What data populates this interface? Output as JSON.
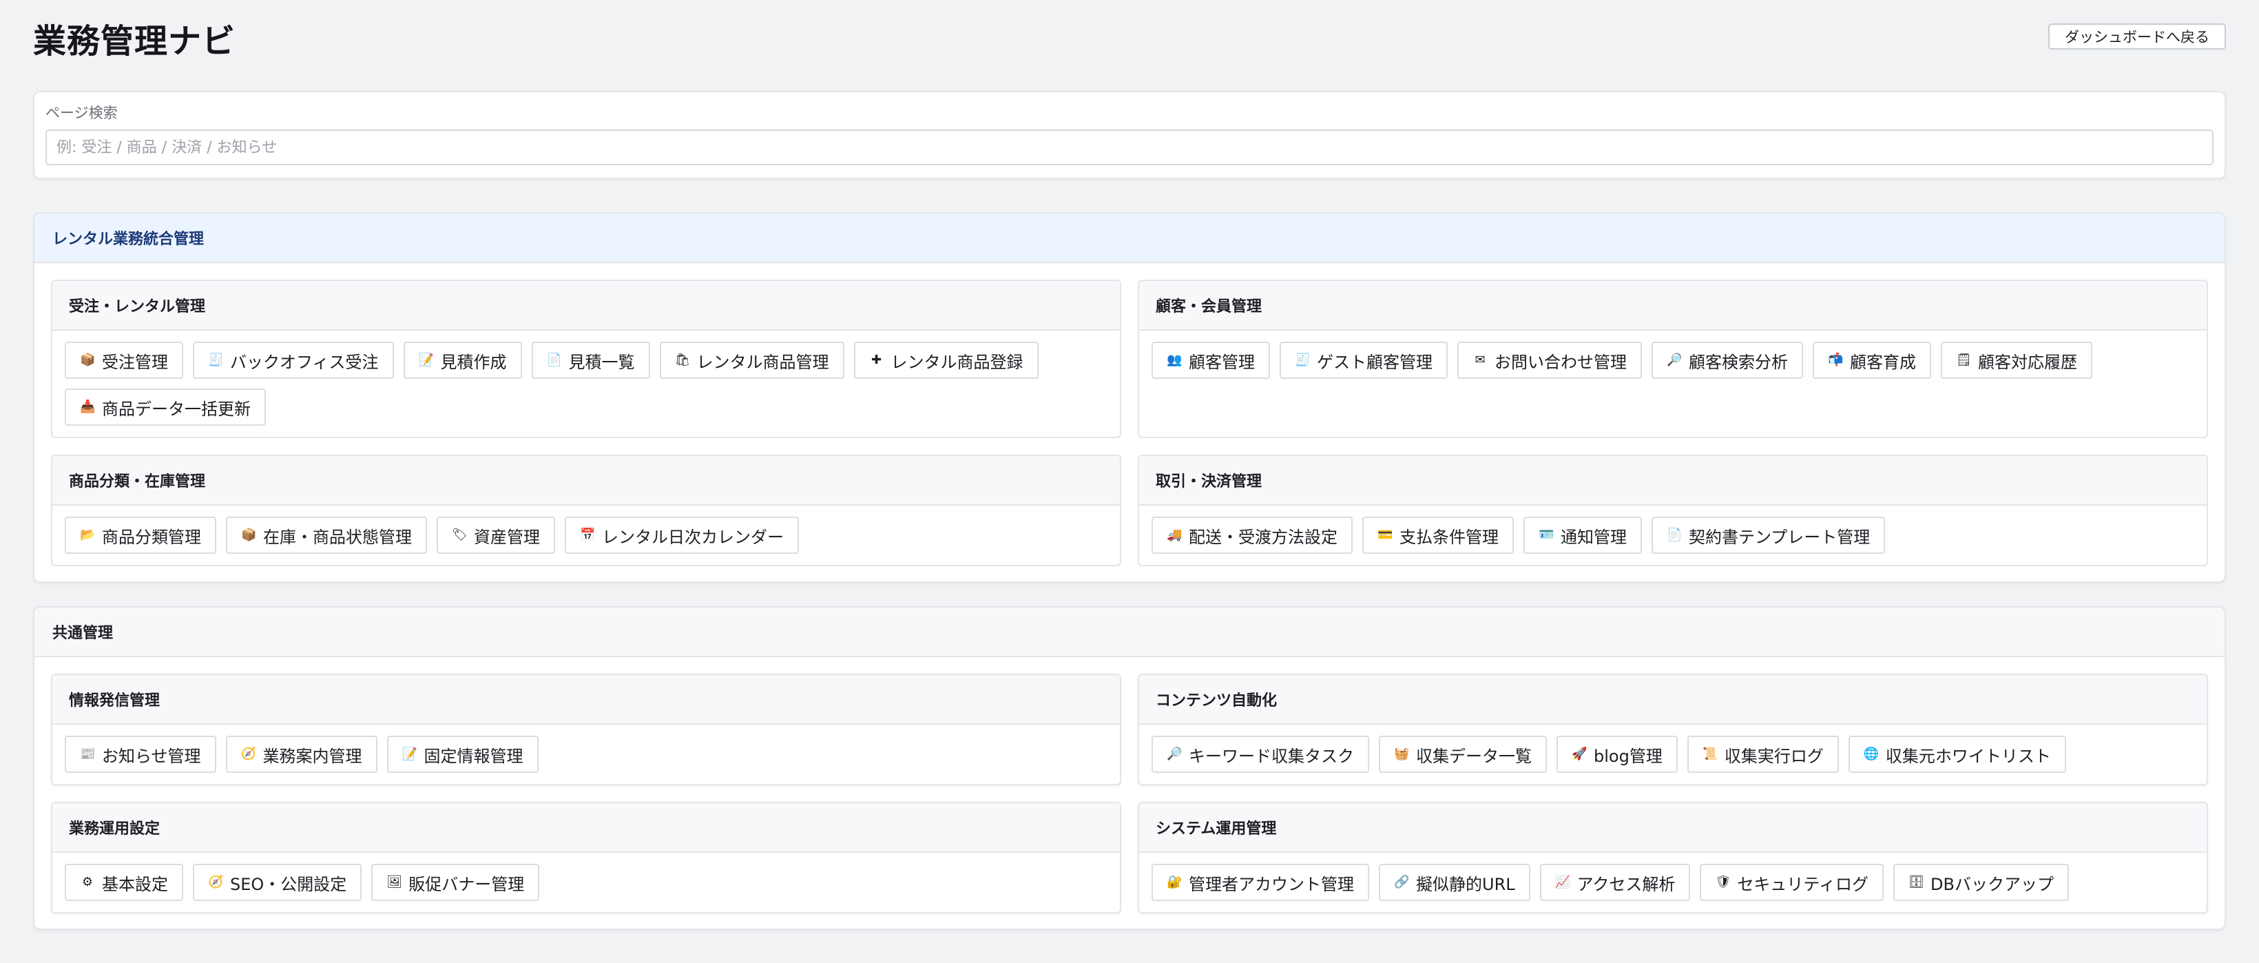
{
  "header": {
    "title": "業務管理ナビ",
    "back_button": "ダッシュボードへ戻る"
  },
  "search": {
    "label": "ページ検索",
    "placeholder": "例: 受注 / 商品 / 決済 / お知らせ",
    "value": ""
  },
  "sections": [
    {
      "title": "レンタル業務統合管理",
      "style": "blue",
      "groups": [
        {
          "title": "受注・レンタル管理",
          "links": [
            {
              "label": "受注管理",
              "icon": "package-icon",
              "glyph": "📦"
            },
            {
              "label": "バックオフィス受注",
              "icon": "receipt-icon",
              "glyph": "🧾"
            },
            {
              "label": "見積作成",
              "icon": "memo-icon",
              "glyph": "📝"
            },
            {
              "label": "見積一覧",
              "icon": "document-icon",
              "glyph": "📄"
            },
            {
              "label": "レンタル商品管理",
              "icon": "shopping-bag-icon",
              "glyph": "🛍"
            },
            {
              "label": "レンタル商品登録",
              "icon": "plus-icon",
              "glyph": "✚"
            },
            {
              "label": "商品データ一括更新",
              "icon": "inbox-tray-icon",
              "glyph": "📥"
            }
          ]
        },
        {
          "title": "顧客・会員管理",
          "links": [
            {
              "label": "顧客管理",
              "icon": "users-icon",
              "glyph": "👥"
            },
            {
              "label": "ゲスト顧客管理",
              "icon": "receipt-icon",
              "glyph": "🧾"
            },
            {
              "label": "お問い合わせ管理",
              "icon": "envelope-icon",
              "glyph": "✉"
            },
            {
              "label": "顧客検索分析",
              "icon": "magnifier-icon",
              "glyph": "🔎"
            },
            {
              "label": "顧客育成",
              "icon": "mailbox-icon",
              "glyph": "📬"
            },
            {
              "label": "顧客対応履歴",
              "icon": "notepad-icon",
              "glyph": "🗒"
            }
          ]
        },
        {
          "title": "商品分類・在庫管理",
          "links": [
            {
              "label": "商品分類管理",
              "icon": "folder-icon",
              "glyph": "📂"
            },
            {
              "label": "在庫・商品状態管理",
              "icon": "package-icon",
              "glyph": "📦"
            },
            {
              "label": "資産管理",
              "icon": "tag-icon",
              "glyph": "🏷"
            },
            {
              "label": "レンタル日次カレンダー",
              "icon": "calendar-icon",
              "glyph": "📅"
            }
          ]
        },
        {
          "title": "取引・決済管理",
          "links": [
            {
              "label": "配送・受渡方法設定",
              "icon": "truck-icon",
              "glyph": "🚚"
            },
            {
              "label": "支払条件管理",
              "icon": "credit-card-icon",
              "glyph": "💳"
            },
            {
              "label": "通知管理",
              "icon": "id-card-icon",
              "glyph": "🪪"
            },
            {
              "label": "契約書テンプレート管理",
              "icon": "document-icon",
              "glyph": "📄"
            }
          ]
        }
      ]
    },
    {
      "title": "共通管理",
      "style": "gray",
      "groups": [
        {
          "title": "情報発信管理",
          "links": [
            {
              "label": "お知らせ管理",
              "icon": "newspaper-icon",
              "glyph": "📰"
            },
            {
              "label": "業務案内管理",
              "icon": "compass-icon",
              "glyph": "🧭"
            },
            {
              "label": "固定情報管理",
              "icon": "memo-icon",
              "glyph": "📝"
            }
          ]
        },
        {
          "title": "コンテンツ自動化",
          "links": [
            {
              "label": "キーワード収集タスク",
              "icon": "magnifier-icon",
              "glyph": "🔎"
            },
            {
              "label": "収集データ一覧",
              "icon": "basket-icon",
              "glyph": "🧺"
            },
            {
              "label": "blog管理",
              "icon": "rocket-icon",
              "glyph": "🚀"
            },
            {
              "label": "収集実行ログ",
              "icon": "scroll-icon",
              "glyph": "📜"
            },
            {
              "label": "収集元ホワイトリスト",
              "icon": "globe-icon",
              "glyph": "🌐"
            }
          ]
        },
        {
          "title": "業務運用設定",
          "links": [
            {
              "label": "基本設定",
              "icon": "gear-icon",
              "glyph": "⚙"
            },
            {
              "label": "SEO・公開設定",
              "icon": "compass-icon",
              "glyph": "🧭"
            },
            {
              "label": "販促バナー管理",
              "icon": "picture-icon",
              "glyph": "🖼"
            }
          ]
        },
        {
          "title": "システム運用管理",
          "links": [
            {
              "label": "管理者アカウント管理",
              "icon": "lock-key-icon",
              "glyph": "🔐"
            },
            {
              "label": "擬似静的URL",
              "icon": "link-icon",
              "glyph": "🔗"
            },
            {
              "label": "アクセス解析",
              "icon": "chart-icon",
              "glyph": "📈"
            },
            {
              "label": "セキュリティログ",
              "icon": "shield-icon",
              "glyph": "🛡"
            },
            {
              "label": "DBバックアップ",
              "icon": "database-icon",
              "glyph": "🗄"
            }
          ]
        }
      ]
    }
  ]
}
